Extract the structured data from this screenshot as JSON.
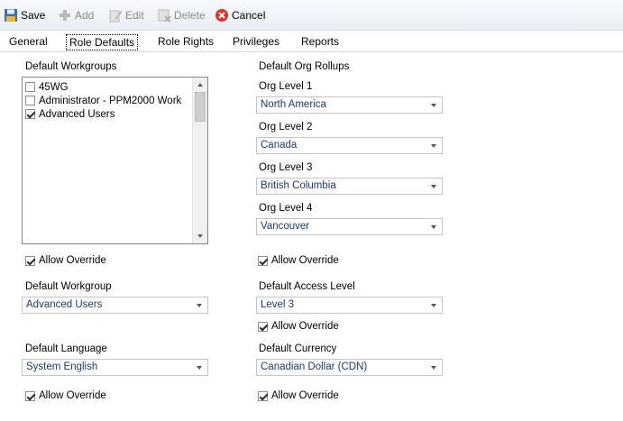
{
  "toolbar": {
    "save": "Save",
    "add": "Add",
    "edit": "Edit",
    "delete": "Delete",
    "cancel": "Cancel"
  },
  "tabs": {
    "general": "General",
    "role_defaults": "Role Defaults",
    "role_rights": "Role Rights",
    "privileges": "Privileges",
    "reports": "Reports"
  },
  "workgroups": {
    "label": "Default Workgroups",
    "items": [
      {
        "label": "45WG",
        "checked": false
      },
      {
        "label": "Administrator - PPM2000 Work",
        "checked": false
      },
      {
        "label": "Advanced Users",
        "checked": true
      }
    ],
    "allow_override": "Allow Override"
  },
  "org_rollups": {
    "label": "Default Org Rollups",
    "level1_label": "Org Level 1",
    "level1_value": "North America",
    "level2_label": "Org Level 2",
    "level2_value": "Canada",
    "level3_label": "Org Level 3",
    "level3_value": "British Columbia",
    "level4_label": "Org Level 4",
    "level4_value": "Vancouver",
    "allow_override": "Allow Override"
  },
  "default_workgroup": {
    "label": "Default Workgroup",
    "value": "Advanced Users"
  },
  "access_level": {
    "label": "Default Access Level",
    "value": "Level 3",
    "allow_override": "Allow Override"
  },
  "language": {
    "label": "Default Language",
    "value": "System English",
    "allow_override": "Allow Override"
  },
  "currency": {
    "label": "Default Currency",
    "value": "Canadian Dollar (CDN)",
    "allow_override": "Allow Override"
  },
  "colors": {
    "combo_text": "#1f3a6b",
    "toolbar_bg": "#eef2f7",
    "cancel_red": "#d9342b"
  }
}
